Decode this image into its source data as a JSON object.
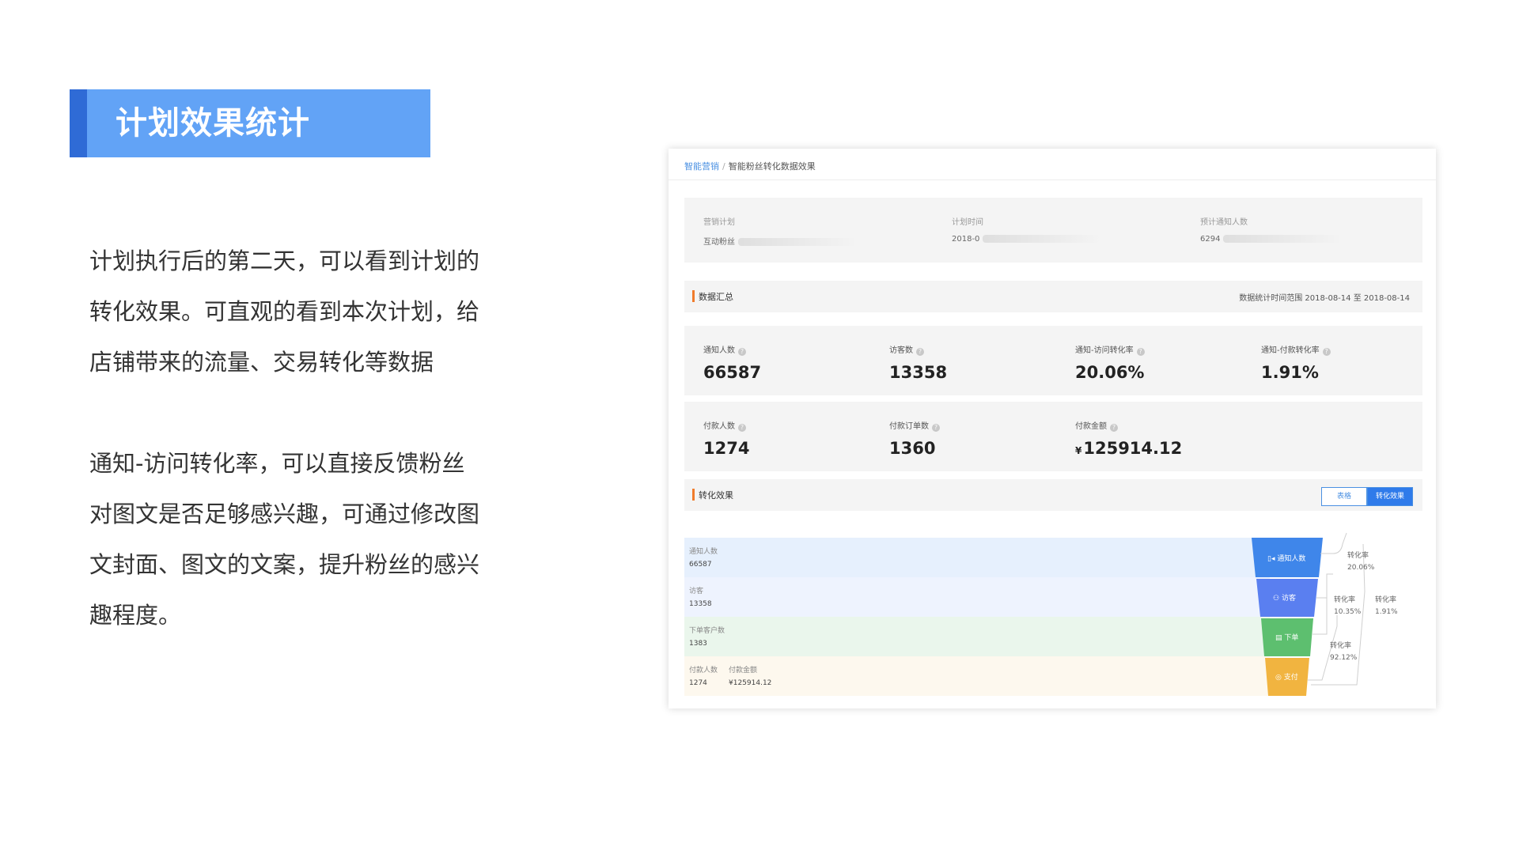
{
  "slide": {
    "title": "计划效果统计",
    "paragraph1": [
      "计划执行后的第二天，可以看到计划的",
      "转化效果。可直观的看到本次计划，给",
      "店铺带来的流量、交易转化等数据"
    ],
    "paragraph2": [
      "通知-访问转化率，可以直接反馈粉丝",
      "对图文是否足够感兴趣，可通过修改图",
      "文封面、图文的文案，提升粉丝的感兴",
      "趣程度。"
    ]
  },
  "screenshot": {
    "breadcrumb": {
      "parent": "智能营销",
      "separator": "/",
      "current": "智能粉丝转化数据效果"
    },
    "info": [
      {
        "label": "营销计划",
        "value": "互动粉丝"
      },
      {
        "label": "计划时间",
        "value": "2018-0"
      },
      {
        "label": "预计通知人数",
        "value": "6294"
      }
    ],
    "summary": {
      "title": "数据汇总",
      "range": "数据统计时间范围 2018-08-14 至 2018-08-14",
      "stats_row1": [
        {
          "label": "通知人数",
          "value": "66587"
        },
        {
          "label": "访客数",
          "value": "13358"
        },
        {
          "label": "通知-访问转化率",
          "value": "20.06%"
        },
        {
          "label": "通知-付款转化率",
          "value": "1.91%"
        }
      ],
      "stats_row2": [
        {
          "label": "付款人数",
          "value": "1274"
        },
        {
          "label": "付款订单数",
          "value": "1360"
        },
        {
          "label": "付款金额",
          "currency": "¥",
          "value": "125914.12"
        }
      ],
      "help_icon": "?"
    },
    "conversion": {
      "title": "转化效果",
      "toggle": {
        "table": "表格",
        "funnel": "转化效果"
      },
      "rows": [
        {
          "label": "通知人数",
          "value": "66587"
        },
        {
          "label": "访客",
          "value": "13358"
        },
        {
          "label": "下单客户数",
          "value": "1383"
        },
        {
          "label": "付款人数",
          "value": "1274",
          "label2": "付款金额",
          "value2": "¥125914.12"
        }
      ],
      "funnel_stages": [
        {
          "name": "通知人数",
          "icon": "megaphone-icon",
          "color": "#3f86ea"
        },
        {
          "name": "访客",
          "icon": "users-icon",
          "color": "#5a7ff0"
        },
        {
          "name": "下单",
          "icon": "clipboard-icon",
          "color": "#5dbf6f"
        },
        {
          "name": "支付",
          "icon": "wallet-icon",
          "color": "#f1b440"
        }
      ],
      "rates": [
        {
          "label": "转化率",
          "value": "20.06%"
        },
        {
          "label": "转化率",
          "value": "10.35%"
        },
        {
          "label": "转化率",
          "value": "1.91%"
        },
        {
          "label": "转化率",
          "value": "92.12%"
        }
      ]
    }
  }
}
